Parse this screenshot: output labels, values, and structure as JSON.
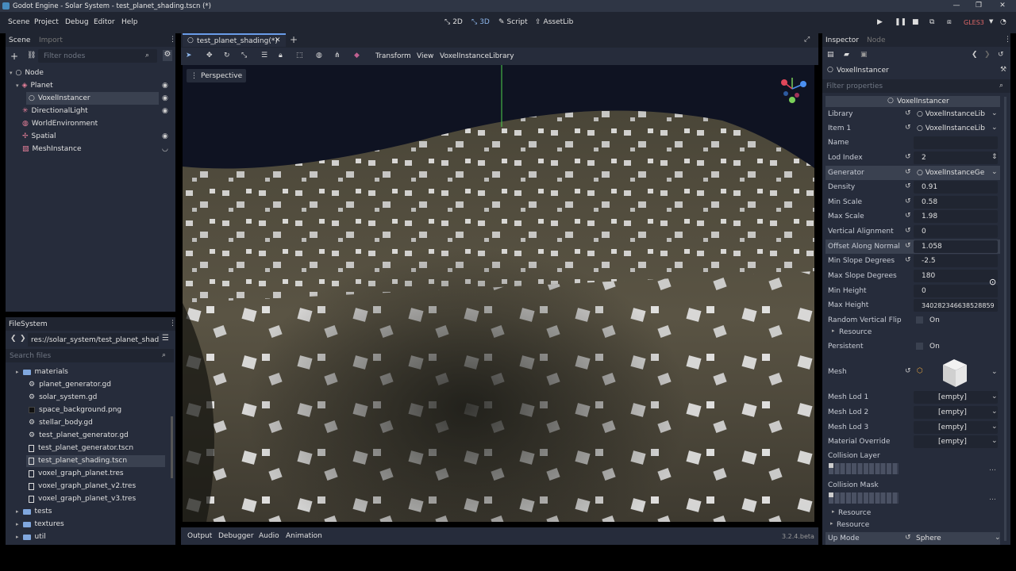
{
  "window": {
    "title": "Godot Engine - Solar System - test_planet_shading.tscn (*)"
  },
  "menu": {
    "scene": "Scene",
    "project": "Project",
    "debug": "Debug",
    "editor": "Editor",
    "help": "Help"
  },
  "workspaces": {
    "w2d": "2D",
    "w3d": "3D",
    "script": "Script",
    "assetlib": "AssetLib"
  },
  "renderer": "GLES3",
  "scene_dock": {
    "tab_scene": "Scene",
    "tab_import": "Import",
    "filter_placeholder": "Filter nodes",
    "nodes": [
      {
        "label": "Node"
      },
      {
        "label": "Planet"
      },
      {
        "label": "VoxelInstancer"
      },
      {
        "label": "DirectionalLight"
      },
      {
        "label": "WorldEnvironment"
      },
      {
        "label": "Spatial"
      },
      {
        "label": "MeshInstance"
      }
    ]
  },
  "filesystem": {
    "title": "FileSystem",
    "path": "res://solar_system/test_planet_shading",
    "search_placeholder": "Search files",
    "items": [
      {
        "label": "materials"
      },
      {
        "label": "planet_generator.gd"
      },
      {
        "label": "solar_system.gd"
      },
      {
        "label": "space_background.png"
      },
      {
        "label": "stellar_body.gd"
      },
      {
        "label": "test_planet_generator.gd"
      },
      {
        "label": "test_planet_generator.tscn"
      },
      {
        "label": "test_planet_shading.tscn"
      },
      {
        "label": "voxel_graph_planet.tres"
      },
      {
        "label": "voxel_graph_planet_v2.tres"
      },
      {
        "label": "voxel_graph_planet_v3.tres"
      },
      {
        "label": "tests"
      },
      {
        "label": "textures"
      },
      {
        "label": "util"
      }
    ]
  },
  "editor": {
    "tab": "test_planet_shading(*)",
    "toolbar": {
      "transform": "Transform",
      "view": "View",
      "lib": "VoxelInstanceLibrary"
    },
    "perspective": "Perspective"
  },
  "bottom": {
    "output": "Output",
    "debugger": "Debugger",
    "audio": "Audio",
    "animation": "Animation",
    "version": "3.2.4.beta"
  },
  "inspector": {
    "tab_inspector": "Inspector",
    "tab_node": "Node",
    "object": "VoxelInstancer",
    "filter_placeholder": "Filter properties",
    "section": "VoxelInstancer",
    "library_label": "Library",
    "library_value": "VoxelInstanceLib",
    "item_label": "Item 1",
    "item_value": "VoxelInstanceLib",
    "name_label": "Name",
    "lod_label": "Lod Index",
    "lod_value": "2",
    "generator_label": "Generator",
    "generator_value": "VoxelInstanceGe",
    "density_label": "Density",
    "density_value": "0.91",
    "min_scale_label": "Min Scale",
    "min_scale_value": "0.58",
    "max_scale_label": "Max Scale",
    "max_scale_value": "1.98",
    "vert_align_label": "Vertical Alignment",
    "vert_align_value": "0",
    "offset_label": "Offset Along Normal",
    "offset_value": "1.058",
    "min_slope_label": "Min Slope Degrees",
    "min_slope_value": "-2.5",
    "max_slope_label": "Max Slope Degrees",
    "max_slope_value": "180",
    "min_height_label": "Min Height",
    "min_height_value": "0",
    "max_height_label": "Max Height",
    "max_height_value": "340282346638528859",
    "flip_label": "Random Vertical Flip",
    "flip_value": "On",
    "resource1": "Resource",
    "persistent_label": "Persistent",
    "persistent_value": "On",
    "mesh_label": "Mesh",
    "lod1_label": "Mesh Lod 1",
    "lod1_value": "[empty]",
    "lod2_label": "Mesh Lod 2",
    "lod2_value": "[empty]",
    "lod3_label": "Mesh Lod 3",
    "lod3_value": "[empty]",
    "mat_label": "Material Override",
    "mat_value": "[empty]",
    "coll_layer_label": "Collision Layer",
    "coll_mask_label": "Collision Mask",
    "resource2": "Resource",
    "resource3": "Resource",
    "up_label": "Up Mode",
    "up_value": "Sphere"
  }
}
